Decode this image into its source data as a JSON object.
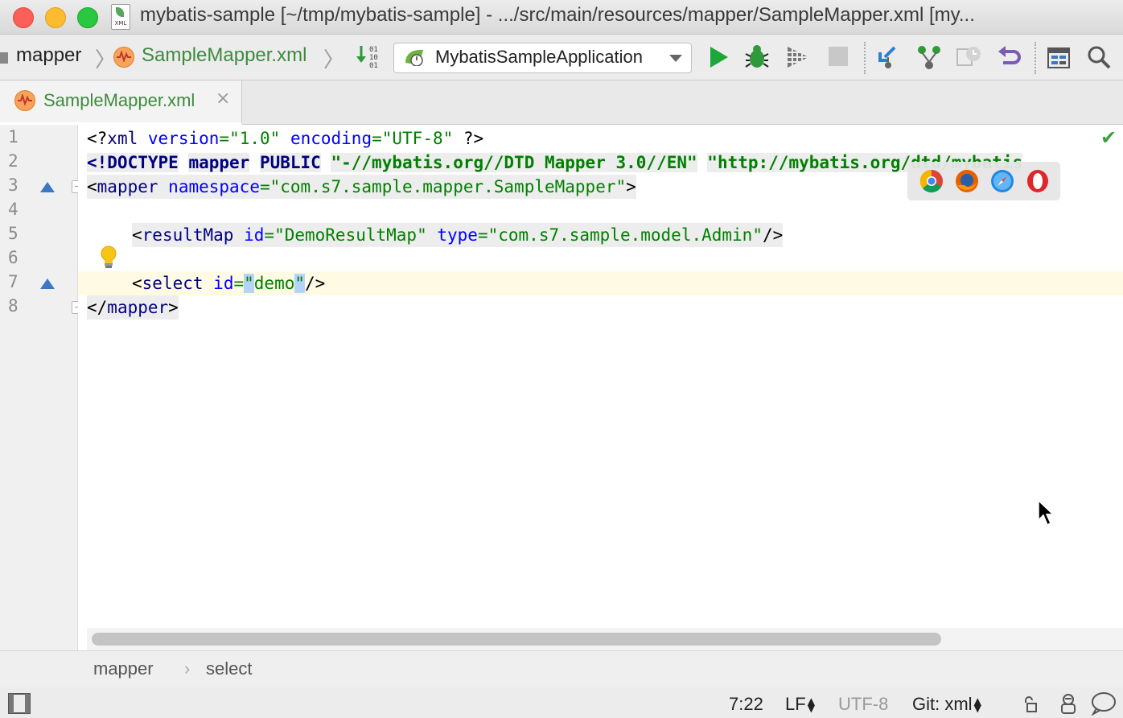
{
  "window": {
    "title": "mybatis-sample [~/tmp/mybatis-sample] - .../src/main/resources/mapper/SampleMapper.xml [my...",
    "file_badge": "XML"
  },
  "navbar": {
    "crumb_folder": "mapper",
    "crumb_file": "SampleMapper.xml",
    "run_config": "MybatisSampleApplication"
  },
  "tab": {
    "label": "SampleMapper.xml",
    "close": "×"
  },
  "editor": {
    "line_numbers": [
      "1",
      "2",
      "3",
      "4",
      "5",
      "6",
      "7",
      "8"
    ],
    "lines": {
      "l1": {
        "a": "<?",
        "b": "xml",
        "c": " ",
        "d": "version",
        "e": "=",
        "f": "\"1.0\"",
        "g": " ",
        "h": "encoding",
        "i": "=",
        "j": "\"UTF-8\"",
        "k": " ?>"
      },
      "l2": {
        "a": "<!DOCTYPE",
        "b": "mapper",
        "c": "PUBLIC",
        "d": "\"-//mybatis.org//DTD Mapper 3.0//EN\"",
        "e": "\"http://mybatis.org/dtd/mybatis"
      },
      "l3": {
        "a": "<",
        "b": "mapper",
        "c": " ",
        "d": "namespace",
        "e": "=",
        "f": "\"com.s7.sample.mapper.SampleMapper\"",
        "g": ">"
      },
      "l5": {
        "a": "<",
        "b": "resultMap",
        "c": " ",
        "d": "id",
        "e": "=",
        "f": "\"DemoResultMap\"",
        "g": " ",
        "h": "type",
        "i": "=",
        "j": "\"com.s7.sample.model.Admin\"",
        "k": "/>"
      },
      "l7": {
        "a": "<",
        "b": "select",
        "c": " ",
        "d": "id",
        "e": "=",
        "f": "\"",
        "g": "demo",
        "h": "\"",
        "i": "/>"
      },
      "l8": {
        "a": "</",
        "b": "mapper",
        "c": ">"
      }
    },
    "inspection_status": "✔"
  },
  "breadcrumbs": {
    "first": "mapper",
    "separator": "›",
    "second": "select"
  },
  "status": {
    "position": "7:22",
    "line_separator": "LF",
    "encoding": "UTF-8",
    "vcs": "Git: xml"
  },
  "colors": {
    "tag": "#000080",
    "attribute": "#0000ff",
    "string": "#008000",
    "caret_line": "#fffae3",
    "selection": "#b6d3fb"
  },
  "icons": {
    "navbar": [
      "mybatis-file-icon",
      "binary-icon",
      "spring-boot-icon",
      "run-icon",
      "debug-icon",
      "coverage-icon",
      "stop-icon",
      "vcs-update-icon",
      "vcs-commit-icon",
      "vcs-history-icon",
      "revert-icon",
      "project-structure-icon",
      "search-icon"
    ],
    "browsers": [
      "chrome-icon",
      "firefox-icon",
      "safari-icon",
      "opera-icon"
    ],
    "status": [
      "tool-windows-icon",
      "lock-icon",
      "hector-icon",
      "event-log-icon"
    ]
  }
}
